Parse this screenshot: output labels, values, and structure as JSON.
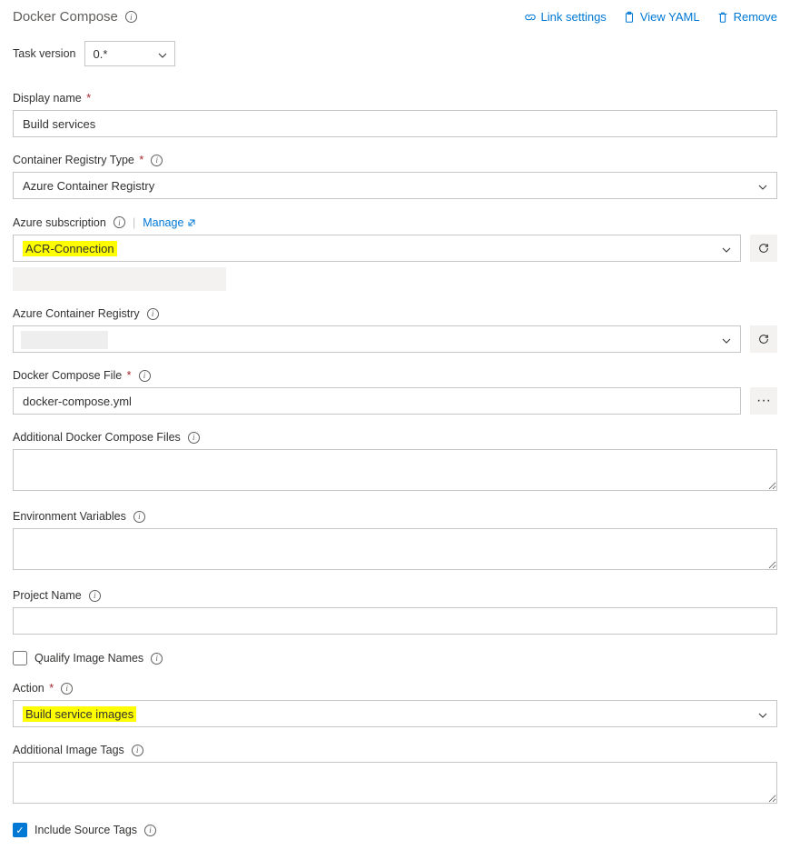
{
  "header": {
    "title": "Docker Compose",
    "links": {
      "link_settings": "Link settings",
      "view_yaml": "View YAML",
      "remove": "Remove"
    }
  },
  "task_version": {
    "label": "Task version",
    "value": "0.*"
  },
  "fields": {
    "display_name": {
      "label": "Display name",
      "value": "Build services"
    },
    "container_registry_type": {
      "label": "Container Registry Type",
      "value": "Azure Container Registry"
    },
    "azure_subscription": {
      "label": "Azure subscription",
      "manage": "Manage",
      "value": "ACR-Connection"
    },
    "azure_container_registry": {
      "label": "Azure Container Registry",
      "value": ""
    },
    "docker_compose_file": {
      "label": "Docker Compose File",
      "value": "docker-compose.yml"
    },
    "additional_compose_files": {
      "label": "Additional Docker Compose Files",
      "value": ""
    },
    "environment_variables": {
      "label": "Environment Variables",
      "value": ""
    },
    "project_name": {
      "label": "Project Name",
      "value": ""
    },
    "qualify_image_names": {
      "label": "Qualify Image Names",
      "checked": false
    },
    "action": {
      "label": "Action",
      "value": "Build service images"
    },
    "additional_image_tags": {
      "label": "Additional Image Tags",
      "value": ""
    },
    "include_source_tags": {
      "label": "Include Source Tags",
      "checked": true
    }
  }
}
